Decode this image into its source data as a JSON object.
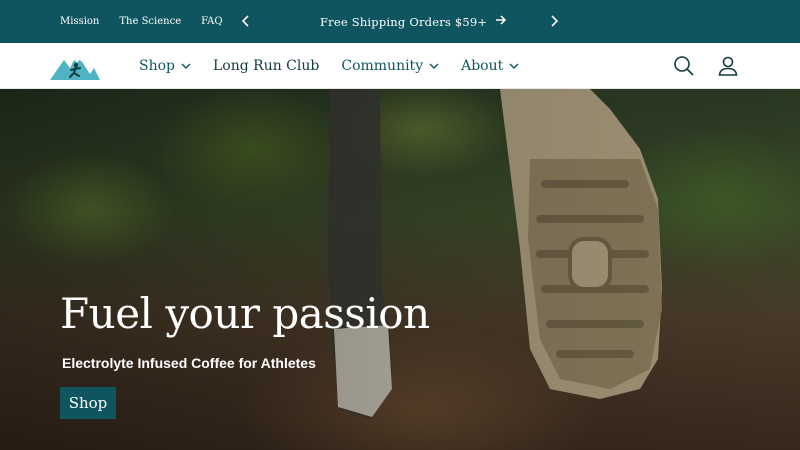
{
  "announcement": {
    "links": [
      "Mission",
      "The Science",
      "FAQ"
    ],
    "message": "Free Shipping Orders $59+",
    "prev_icon": "chevron-left-icon",
    "next_icon": "chevron-right-icon"
  },
  "header": {
    "logo_icon": "mountain-runner-logo",
    "nav": [
      {
        "label": "Shop",
        "has_dropdown": true
      },
      {
        "label": "Long Run Club",
        "has_dropdown": false
      },
      {
        "label": "Community",
        "has_dropdown": true
      },
      {
        "label": "About",
        "has_dropdown": true
      }
    ],
    "search_icon": "search-icon",
    "account_icon": "account-icon"
  },
  "hero": {
    "title": "Fuel your passion",
    "subtitle": "Electrolyte Infused Coffee for Athletes",
    "cta_label": "Shop"
  },
  "colors": {
    "brand_teal": "#0f5560",
    "logo_light": "#4fb3c4",
    "white": "#ffffff"
  }
}
